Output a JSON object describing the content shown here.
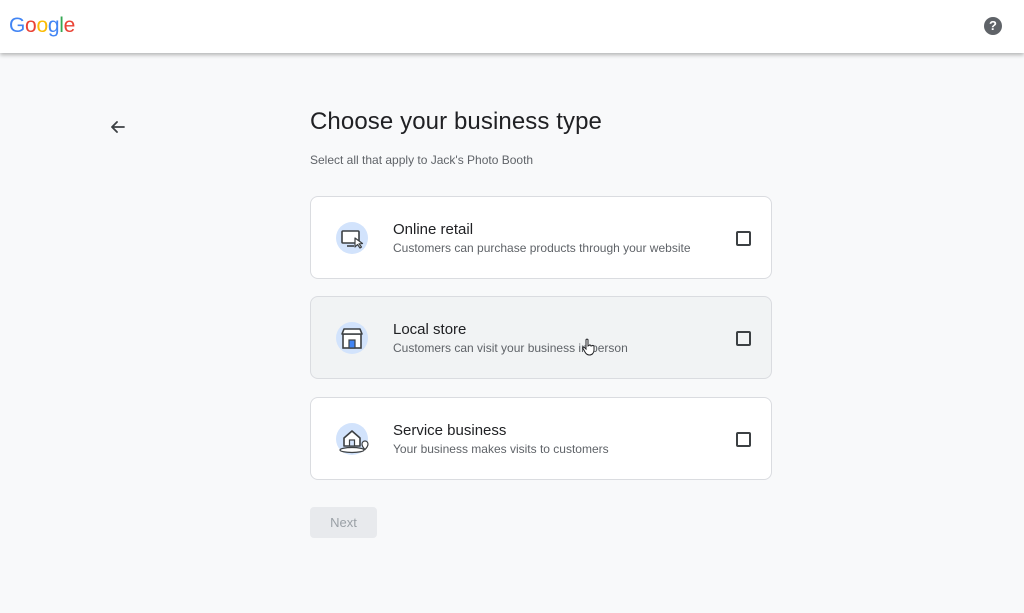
{
  "header": {
    "logo_letters": [
      {
        "ch": "G",
        "color": "#4285F4"
      },
      {
        "ch": "o",
        "color": "#EA4335"
      },
      {
        "ch": "o",
        "color": "#FBBC05"
      },
      {
        "ch": "g",
        "color": "#4285F4"
      },
      {
        "ch": "l",
        "color": "#34A853"
      },
      {
        "ch": "e",
        "color": "#EA4335"
      }
    ],
    "help_icon": "help-circle-icon",
    "help_label": "?"
  },
  "page": {
    "back_icon": "arrow-back-icon",
    "title": "Choose your business type",
    "subtitle": "Select all that apply to Jack's Photo Booth"
  },
  "options": [
    {
      "icon": "monitor-cursor-icon",
      "label": "Online retail",
      "description": "Customers can purchase products through your website",
      "checked": false
    },
    {
      "icon": "storefront-icon",
      "label": "Local store",
      "description": "Customers can visit your business in person",
      "checked": false
    },
    {
      "icon": "house-location-icon",
      "label": "Service business",
      "description": "Your business makes visits to customers",
      "checked": false
    }
  ],
  "actions": {
    "next_label": "Next",
    "next_enabled": false
  },
  "colors": {
    "accent_light": "#d2e3fc",
    "icon_stroke": "#3c4043",
    "disabled_bg": "#e8eaed",
    "disabled_text": "#9aa0a6"
  }
}
